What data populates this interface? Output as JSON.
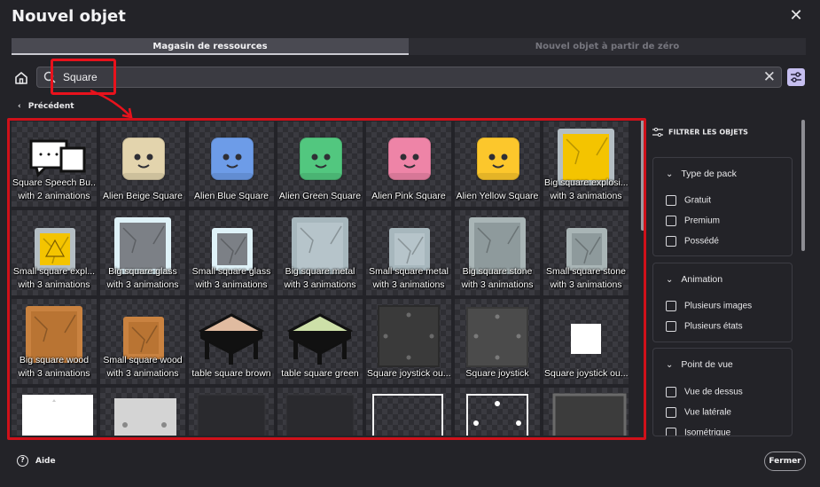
{
  "dialog": {
    "title": "Nouvel objet",
    "close_icon": "close-icon"
  },
  "tabs": [
    {
      "label": "Magasin de ressources",
      "active": true
    },
    {
      "label": "Nouvel objet à partir de zéro",
      "active": false
    }
  ],
  "search": {
    "value": "Square",
    "placeholder": ""
  },
  "nav": {
    "previous_label": "Précédent"
  },
  "assets": [
    {
      "line1": "Square Speech Bu...",
      "line2": "with 2 animations",
      "icon": "speech-bubble"
    },
    {
      "line1": "Alien Beige Square",
      "line2": "",
      "icon": "alien-beige",
      "color": "#e3d4ad"
    },
    {
      "line1": "Alien Blue Square",
      "line2": "",
      "icon": "alien-blue",
      "color": "#6d9ce8"
    },
    {
      "line1": "Alien Green Square",
      "line2": "",
      "icon": "alien-green",
      "color": "#52c77f"
    },
    {
      "line1": "Alien Pink Square",
      "line2": "",
      "icon": "alien-pink",
      "color": "#ee84a7"
    },
    {
      "line1": "Alien Yellow Square",
      "line2": "",
      "icon": "alien-yellow",
      "color": "#fcc72c"
    },
    {
      "line1": "Big square explosi...",
      "line2": "with 3 animations",
      "icon": "big-square-explosive"
    },
    {
      "line1": "Small square expl...",
      "line2": "with 3 animations",
      "icon": "small-square-explosive"
    },
    {
      "line1": "Big square glass",
      "line2": "with 3 animations",
      "icon": "big-square-glass"
    },
    {
      "line1": "Small square glass",
      "line2": "with 3 animations",
      "icon": "small-square-glass"
    },
    {
      "line1": "Big square metal",
      "line2": "with 3 animations",
      "icon": "big-square-metal"
    },
    {
      "line1": "Small square metal",
      "line2": "with 3 animations",
      "icon": "small-square-metal"
    },
    {
      "line1": "Big square stone",
      "line2": "with 3 animations",
      "icon": "big-square-stone"
    },
    {
      "line1": "Small square stone",
      "line2": "with 3 animations",
      "icon": "small-square-stone"
    },
    {
      "line1": "Big square wood",
      "line2": "with 3 animations",
      "icon": "big-square-wood"
    },
    {
      "line1": "Small square wood",
      "line2": "with 3 animations",
      "icon": "small-square-wood"
    },
    {
      "line1": "table square brown",
      "line2": "",
      "icon": "table-brown",
      "color": "#e0bba0"
    },
    {
      "line1": "table square green",
      "line2": "",
      "icon": "table-green",
      "color": "#cde0a8"
    },
    {
      "line1": "Square joystick ou...",
      "line2": "",
      "icon": "joystick-outer"
    },
    {
      "line1": "Square joystick",
      "line2": "",
      "icon": "joystick"
    },
    {
      "line1": "Square joystick ou...",
      "line2": "",
      "icon": "joystick-outer-white"
    },
    {
      "line1": "",
      "line2": "",
      "icon": "white-panel"
    },
    {
      "line1": "",
      "line2": "",
      "icon": "grey-panel"
    },
    {
      "line1": "",
      "line2": "",
      "icon": "dark-panel"
    },
    {
      "line1": "",
      "line2": "",
      "icon": "dark-panel"
    },
    {
      "line1": "",
      "line2": "",
      "icon": "outline-panel"
    },
    {
      "line1": "",
      "line2": "",
      "icon": "outline-dots-panel"
    },
    {
      "line1": "",
      "line2": "",
      "icon": "grey-frame-panel"
    }
  ],
  "filters": {
    "heading": "FILTRER LES OBJETS",
    "groups": [
      {
        "title": "Type de pack",
        "options": [
          "Gratuit",
          "Premium",
          "Possédé"
        ]
      },
      {
        "title": "Animation",
        "options": [
          "Plusieurs images",
          "Plusieurs états"
        ]
      },
      {
        "title": "Point de vue",
        "options": [
          "Vue de dessus",
          "Vue latérale",
          "Isométrique"
        ]
      }
    ]
  },
  "footer": {
    "help_label": "Aide",
    "close_label": "Fermer"
  },
  "colors": {
    "background": "#232328",
    "accent": "#c6bff0",
    "highlight": "#e8121c"
  }
}
